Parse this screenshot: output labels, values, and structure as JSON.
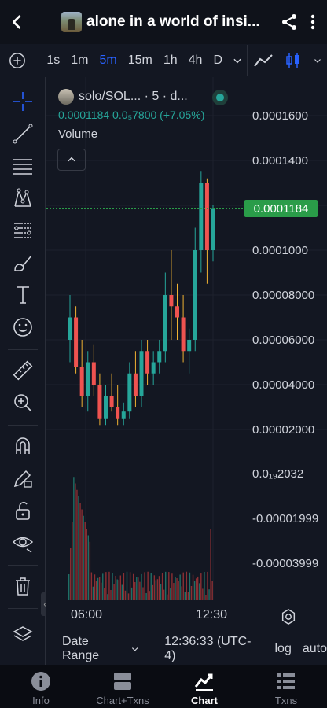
{
  "header": {
    "title": "alone in a world of insi...",
    "back_icon": "back-arrow-icon",
    "share_icon": "share-icon",
    "more_icon": "more-vert-icon"
  },
  "timeframes": {
    "items": [
      "1s",
      "1m",
      "5m",
      "15m",
      "1h",
      "4h",
      "D"
    ],
    "active": "5m"
  },
  "legend": {
    "symbol": "solo/SOL... · 5 · d...",
    "price_change": "0.0001184  0.0₅7800 (+7.05%)",
    "volume_label": "Volume"
  },
  "yaxis": {
    "labels": [
      "0.0001600",
      "0.0001400",
      "0.0001000",
      "0.00008000",
      "0.00006000",
      "0.00004000",
      "0.00002000",
      "0.0₁₉2032",
      "-0.00001999",
      "-0.00003999"
    ],
    "current_price": "0.0001184"
  },
  "xaxis": {
    "labels": [
      "06:00",
      "12:30"
    ]
  },
  "infobar": {
    "date_range": "Date Range",
    "time": "12:36:33 (UTC-4)",
    "log": "log",
    "auto": "auto"
  },
  "nav": {
    "items": [
      {
        "label": "Info",
        "icon": "info-icon"
      },
      {
        "label": "Chart+Txns",
        "icon": "chart-txns-icon"
      },
      {
        "label": "Chart",
        "icon": "chart-icon"
      },
      {
        "label": "Txns",
        "icon": "txns-list-icon"
      }
    ],
    "active": "Chart"
  },
  "colors": {
    "up": "#26a69a",
    "down": "#ef5350",
    "wick_up": "#f0b232",
    "price_tag": "#2a9c49",
    "active_tf": "#2962ff"
  },
  "chart_data": {
    "type": "candlestick",
    "price_range": [
      2e-05,
      0.00016
    ],
    "current_price": 0.0001184,
    "candles": [
      [
        6e-05,
        8e-05,
        5e-05,
        7e-05
      ],
      [
        7e-05,
        7.5e-05,
        4.5e-05,
        4.8e-05
      ],
      [
        4.8e-05,
        6e-05,
        3e-05,
        3.5e-05
      ],
      [
        3.5e-05,
        5.5e-05,
        2.8e-05,
        5e-05
      ],
      [
        5e-05,
        5.8e-05,
        3.5e-05,
        4e-05
      ],
      [
        4e-05,
        4.5e-05,
        2.2e-05,
        2.5e-05
      ],
      [
        2.5e-05,
        4e-05,
        2.2e-05,
        3.5e-05
      ],
      [
        3.5e-05,
        4.5e-05,
        2.8e-05,
        3e-05
      ],
      [
        3e-05,
        4e-05,
        2.2e-05,
        2.5e-05
      ],
      [
        2.5e-05,
        3.2e-05,
        2.2e-05,
        2.8e-05
      ],
      [
        2.8e-05,
        5e-05,
        2.5e-05,
        4.5e-05
      ],
      [
        4.5e-05,
        5.5e-05,
        3e-05,
        3.5e-05
      ],
      [
        3.5e-05,
        6e-05,
        3e-05,
        5.5e-05
      ],
      [
        5.5e-05,
        6e-05,
        4e-05,
        4.5e-05
      ],
      [
        4.5e-05,
        5.5e-05,
        4e-05,
        5e-05
      ],
      [
        5e-05,
        6e-05,
        4.5e-05,
        5.5e-05
      ],
      [
        5.5e-05,
        9e-05,
        5e-05,
        8e-05
      ],
      [
        8e-05,
        0.0001,
        6e-05,
        7.5e-05
      ],
      [
        7.5e-05,
        8.5e-05,
        6e-05,
        7e-05
      ],
      [
        7e-05,
        8e-05,
        5e-05,
        5.5e-05
      ],
      [
        5.5e-05,
        6.5e-05,
        4.5e-05,
        6e-05
      ],
      [
        6e-05,
        0.00011,
        5.5e-05,
        0.0001
      ],
      [
        0.0001,
        0.000135,
        9e-05,
        0.00013
      ],
      [
        0.00013,
        0.000132,
        8.5e-05,
        0.0001
      ],
      [
        0.0001,
        0.00012,
        9.5e-05,
        0.0001184
      ]
    ],
    "volume_max": 1
  }
}
